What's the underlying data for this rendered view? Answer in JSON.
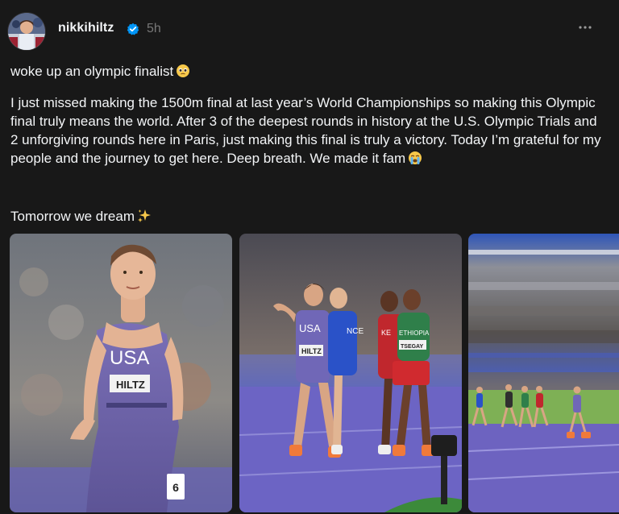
{
  "post": {
    "username": "nikkihiltz",
    "time": "5h",
    "line1": "woke up an olympic finalist",
    "paragraph": "I just missed making the 1500m final at last year’s World Championships so making this Olympic final truly means the world. After 3 of the deepest rounds in history at the U.S. Olympic Trials and 2 unforgiving rounds here in Paris, just making this final is truly a victory. Today I’m grateful for my people and the journey to get here. Deep breath. We made it fam",
    "line3": "Tomorrow we dream"
  },
  "icons": {
    "verified": "verified-badge-icon",
    "more": "more-options-icon",
    "emoji1": "pleading-face-emoji",
    "emoji2": "loudly-crying-face-emoji",
    "emoji3": "sparkles-emoji"
  },
  "photos": {
    "photo1": {
      "jersey_text": "USA",
      "bib_text": "HILTZ",
      "number": "6"
    },
    "photo2": {
      "jersey_text_usa": "USA",
      "bib_hiltz": "HILTZ",
      "jersey_text_france": "NCE",
      "jersey_text_ken": "KE",
      "jersey_text_eth": "ETHIOPIA",
      "bib_eth": "TSEGAY"
    }
  },
  "colors": {
    "background": "#181818",
    "text": "#f3f5f7",
    "muted": "#777777",
    "verified": "#0095f6"
  }
}
